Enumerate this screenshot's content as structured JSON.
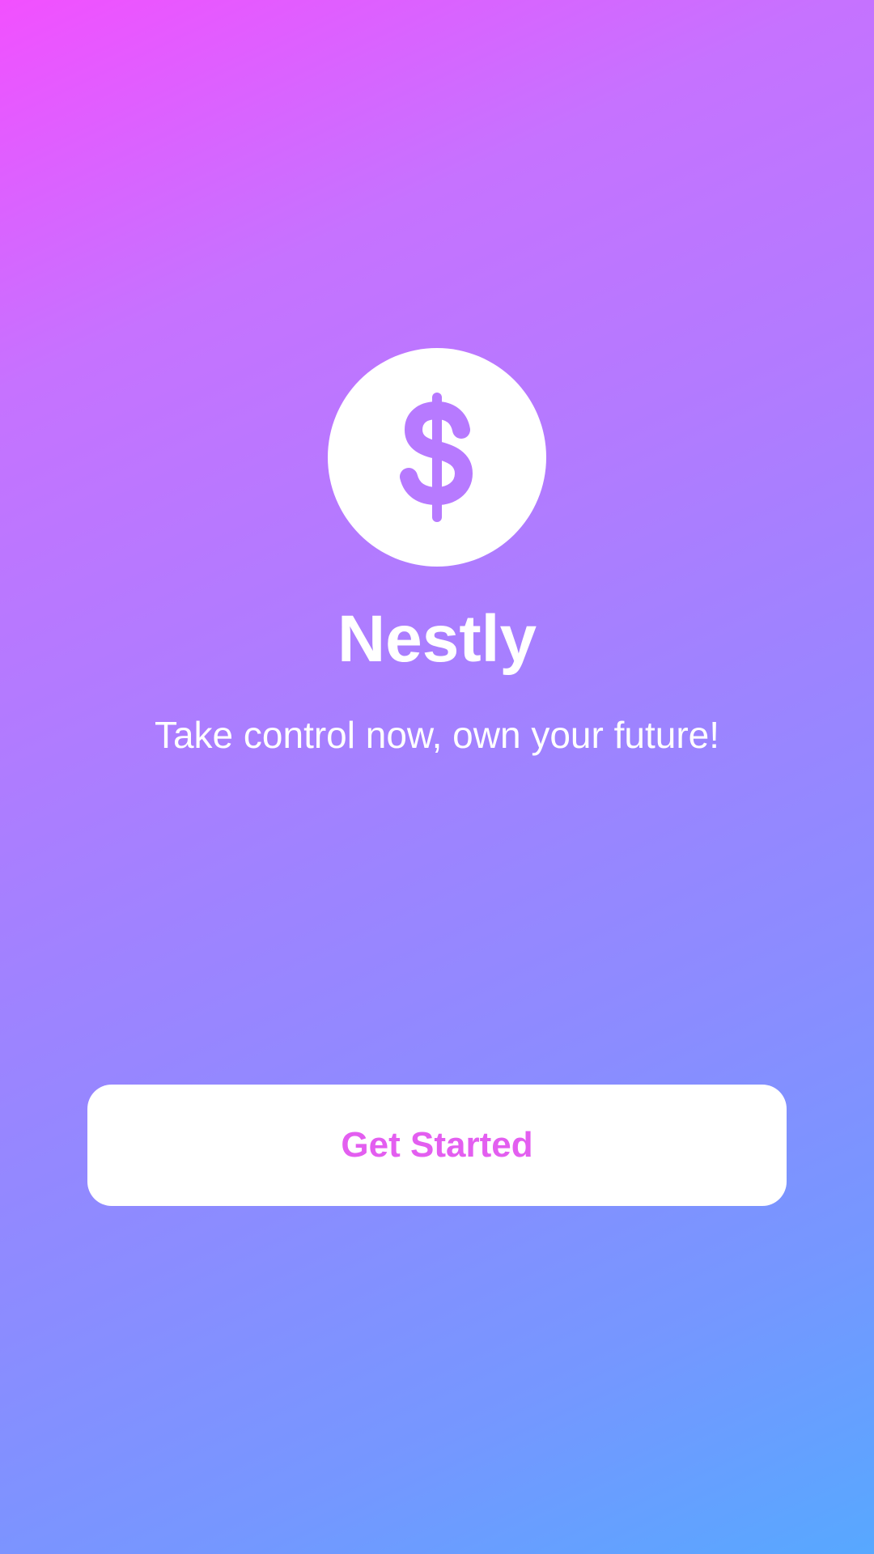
{
  "app": {
    "name": "Nestly",
    "tagline": "Take control now, own your future!",
    "logo_icon": "dollar-icon"
  },
  "actions": {
    "get_started_label": "Get Started"
  },
  "colors": {
    "gradient_start": "#f250ff",
    "gradient_end": "#57a8ff",
    "icon_color": "#b77aff",
    "button_text": "#e35ef0",
    "surface": "#ffffff"
  }
}
